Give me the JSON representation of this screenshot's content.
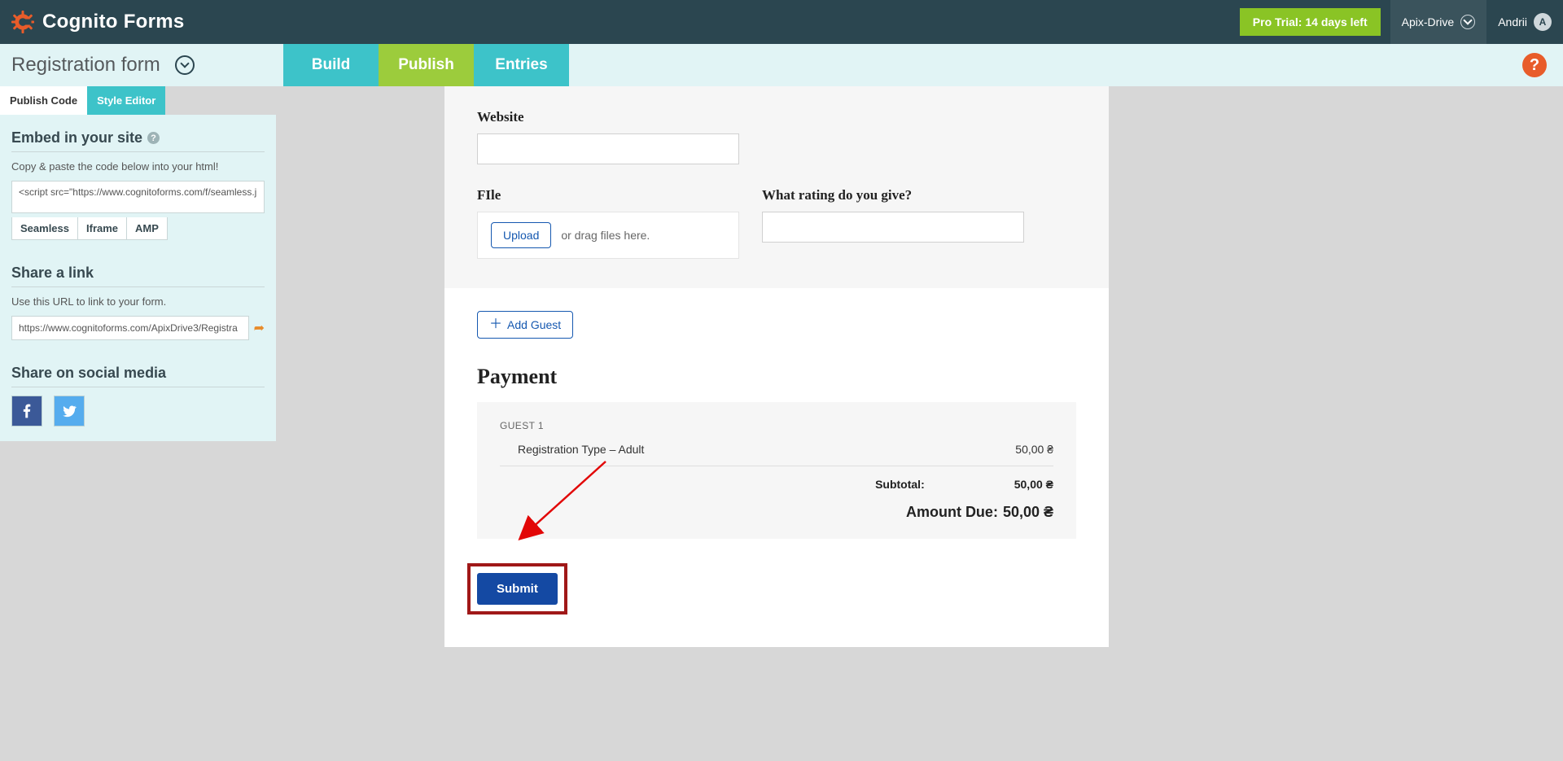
{
  "header": {
    "brand": "Cognito Forms",
    "trial": "Pro Trial: 14 days left",
    "org": "Apix-Drive",
    "user": "Andrii",
    "user_initial": "A"
  },
  "subheader": {
    "form_title": "Registration form",
    "tabs": {
      "build": "Build",
      "publish": "Publish",
      "entries": "Entries"
    },
    "help": "?"
  },
  "left": {
    "tabs": {
      "publish_code": "Publish Code",
      "style_editor": "Style Editor"
    },
    "embed": {
      "title": "Embed in your site",
      "desc": "Copy & paste the code below into your html!",
      "code": "<script src=\"https://www.cognitoforms.com/f/seamless.j",
      "code_tabs": {
        "seamless": "Seamless",
        "iframe": "Iframe",
        "amp": "AMP"
      }
    },
    "share_link": {
      "title": "Share a link",
      "desc": "Use this URL to link to your form.",
      "url": "https://www.cognitoforms.com/ApixDrive3/Registra"
    },
    "social": {
      "title": "Share on social media"
    }
  },
  "form": {
    "website_label": "Website",
    "file_label": "FIle",
    "rating_label": "What rating do you give?",
    "upload_btn": "Upload",
    "upload_hint": "or drag files here.",
    "add_guest": "Add Guest",
    "payment": {
      "title": "Payment",
      "guest_label": "GUEST 1",
      "line_item": "Registration Type – Adult",
      "line_price": "50,00 ₴",
      "subtotal_label": "Subtotal:",
      "subtotal_value": "50,00 ₴",
      "due_label": "Amount Due:",
      "due_value": "50,00 ₴"
    },
    "submit": "Submit"
  }
}
